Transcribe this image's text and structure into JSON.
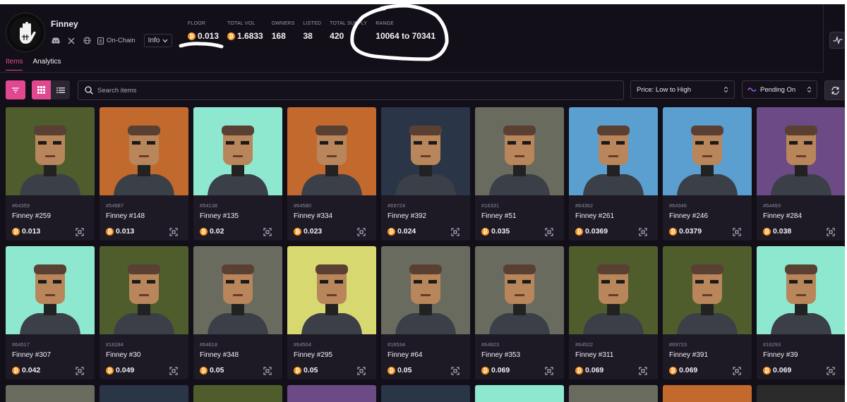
{
  "collection": {
    "name": "Finney",
    "onchain_label": "On-Chain",
    "info_label": "Info"
  },
  "stats": [
    {
      "label": "FLOOR",
      "value": "0.013",
      "btc": true
    },
    {
      "label": "TOTAL VOL",
      "value": "1.6833",
      "btc": true
    },
    {
      "label": "OWNERS",
      "value": "168",
      "btc": false
    },
    {
      "label": "LISTED",
      "value": "38",
      "btc": false
    },
    {
      "label": "TOTAL SUPPLY",
      "value": "420",
      "btc": false
    },
    {
      "label": "RANGE",
      "value": "10064 to 70341",
      "btc": false
    }
  ],
  "tabs": [
    {
      "label": "Items",
      "active": true
    },
    {
      "label": "Analytics",
      "active": false
    }
  ],
  "toolbar": {
    "search_placeholder": "Search items",
    "sort_label": "Price: Low to High",
    "pending_label": "Pending On"
  },
  "items": [
    {
      "inscription": "#64359",
      "name": "Finney #259",
      "price": "0.013",
      "bg": "#4e5d2b"
    },
    {
      "inscription": "#54987",
      "name": "Finney #148",
      "price": "0.013",
      "bg": "#c2692e"
    },
    {
      "inscription": "#54138",
      "name": "Finney #135",
      "price": "0.02",
      "bg": "#8ee8d0"
    },
    {
      "inscription": "#64580",
      "name": "Finney #334",
      "price": "0.023",
      "bg": "#c2692e"
    },
    {
      "inscription": "#69724",
      "name": "Finney #392",
      "price": "0.024",
      "bg": "#2a3548"
    },
    {
      "inscription": "#16331",
      "name": "Finney #51",
      "price": "0.035",
      "bg": "#6a6b5f"
    },
    {
      "inscription": "#64362",
      "name": "Finney #261",
      "price": "0.0369",
      "bg": "#5a9fd0"
    },
    {
      "inscription": "#64346",
      "name": "Finney #246",
      "price": "0.0379",
      "bg": "#5a9fd0"
    },
    {
      "inscription": "#64493",
      "name": "Finney #284",
      "price": "0.038",
      "bg": "#6b4a85"
    },
    {
      "inscription": "#64517",
      "name": "Finney #307",
      "price": "0.042",
      "bg": "#8ee8d0"
    },
    {
      "inscription": "#16284",
      "name": "Finney #30",
      "price": "0.049",
      "bg": "#4e5d2b"
    },
    {
      "inscription": "#64618",
      "name": "Finney #348",
      "price": "0.05",
      "bg": "#6a6b5f"
    },
    {
      "inscription": "#64504",
      "name": "Finney #295",
      "price": "0.05",
      "bg": "#d8d870"
    },
    {
      "inscription": "#16534",
      "name": "Finney #64",
      "price": "0.05",
      "bg": "#6a6b5f"
    },
    {
      "inscription": "#64623",
      "name": "Finney #353",
      "price": "0.069",
      "bg": "#6a6b5f"
    },
    {
      "inscription": "#64522",
      "name": "Finney #311",
      "price": "0.069",
      "bg": "#4e5d2b"
    },
    {
      "inscription": "#69723",
      "name": "Finney #391",
      "price": "0.069",
      "bg": "#4e5d2b"
    },
    {
      "inscription": "#16293",
      "name": "Finney #39",
      "price": "0.069",
      "bg": "#8ee8d0"
    }
  ],
  "partial_row_colors": [
    "#6a6b5f",
    "#2a3548",
    "#4e5d2b",
    "#6b4a85",
    "#2a3548",
    "#8ee8d0",
    "#6a6b5f",
    "#c2692e",
    "#2a2a2a"
  ],
  "colors": {
    "accent": "#e0488f",
    "background": "#130f19",
    "card": "#1d1925",
    "bitcoin": "#f7931a"
  }
}
